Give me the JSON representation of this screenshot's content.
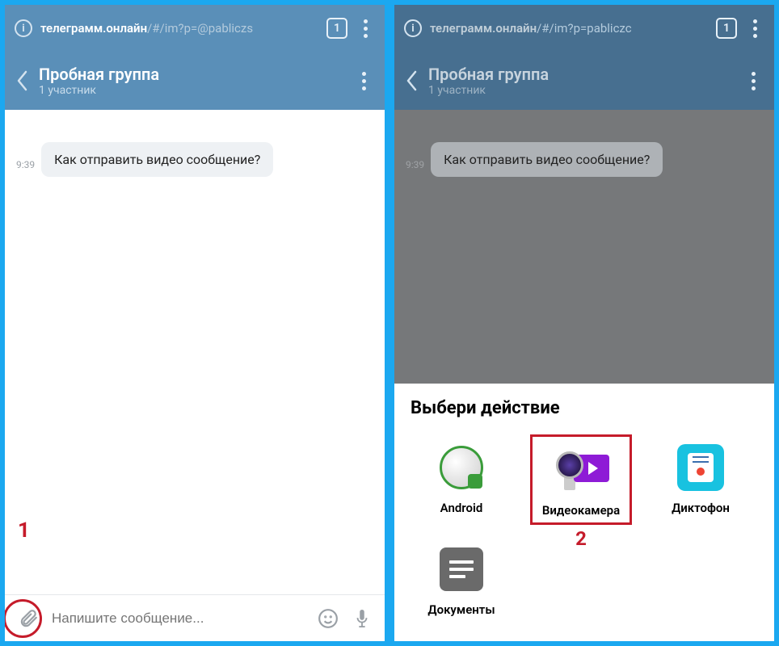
{
  "left": {
    "browser": {
      "url_host": "телеграмм.онлайн",
      "url_path": "/#/im?p=@pabliczs",
      "tab_count": "1"
    },
    "header": {
      "title": "Пробная группа",
      "subtitle": "1 участник"
    },
    "message": {
      "time": "9:39",
      "text": "Как отправить видео сообщение?"
    },
    "input": {
      "placeholder": "Напишите сообщение..."
    },
    "annotation": "1"
  },
  "right": {
    "browser": {
      "url_host": "телеграмм.онлайн",
      "url_path": "/#/im?p=pabliczc",
      "tab_count": "1"
    },
    "header": {
      "title": "Пробная группа",
      "subtitle": "1 участник"
    },
    "message": {
      "time": "9:39",
      "text": "Как отправить видео сообщение?"
    },
    "sheet": {
      "title": "Выбери действие",
      "items": [
        {
          "label": "Android"
        },
        {
          "label": "Видеокамера"
        },
        {
          "label": "Диктофон"
        },
        {
          "label": "Документы"
        }
      ]
    },
    "annotation": "2"
  }
}
